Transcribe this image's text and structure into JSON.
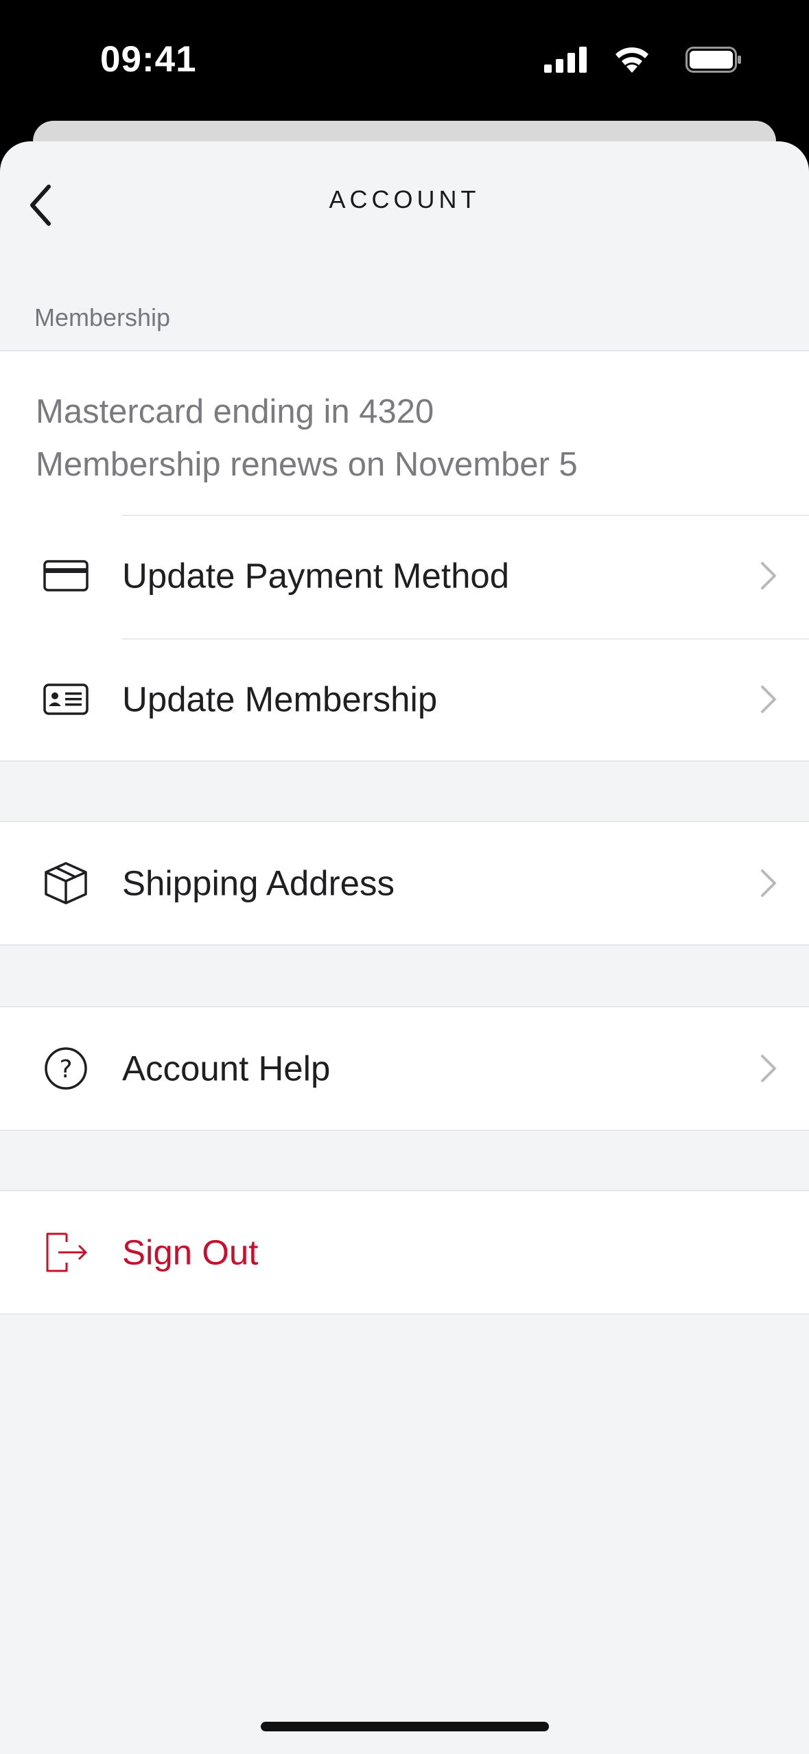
{
  "status_bar": {
    "time": "09:41",
    "icons": [
      "cellular-signal-icon",
      "wifi-icon",
      "battery-icon"
    ]
  },
  "nav": {
    "title": "ACCOUNT",
    "back_icon": "chevron-left-icon"
  },
  "membership": {
    "section_title": "Membership",
    "card_line": "Mastercard ending in 4320",
    "renew_line": "Membership renews on November 5",
    "items": [
      {
        "label": "Update Payment Method",
        "icon": "credit-card-icon"
      },
      {
        "label": "Update Membership",
        "icon": "id-card-icon"
      }
    ]
  },
  "shipping": {
    "label": "Shipping Address",
    "icon": "package-box-icon"
  },
  "help": {
    "label": "Account Help",
    "icon": "question-circle-icon"
  },
  "sign_out": {
    "label": "Sign Out",
    "icon": "sign-out-icon"
  },
  "colors": {
    "background": "#f3f4f6",
    "surface": "#ffffff",
    "text": "#1f1f22",
    "secondary_text": "#7a7a7f",
    "danger": "#c8102e",
    "chevron": "#b9b9be"
  }
}
